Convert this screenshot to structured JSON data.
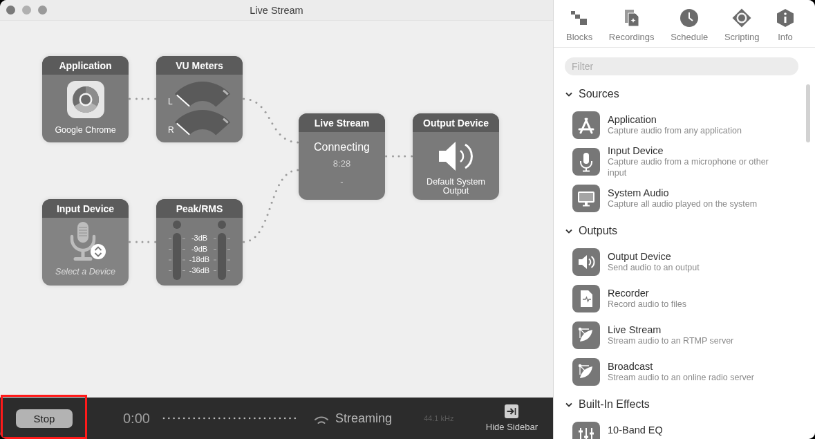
{
  "window": {
    "title": "Live Stream"
  },
  "canvas": {
    "nodes": [
      {
        "kind": "application",
        "title": "Application",
        "label": "Google Chrome"
      },
      {
        "kind": "vu_meters",
        "title": "VU Meters",
        "channels": [
          "L",
          "R"
        ]
      },
      {
        "kind": "live_stream",
        "title": "Live Stream",
        "status": "Connecting",
        "time": "8:28",
        "detail": "-"
      },
      {
        "kind": "output_device",
        "title": "Output Device",
        "label": "Default System Output"
      },
      {
        "kind": "input_device",
        "title": "Input Device",
        "prompt": "Select a Device"
      },
      {
        "kind": "peak_rms",
        "title": "Peak/RMS",
        "scale": [
          "-3dB",
          "-9dB",
          "-18dB",
          "-36dB"
        ]
      }
    ]
  },
  "sidebar": {
    "tabs": [
      {
        "kind": "blocks",
        "label": "Blocks"
      },
      {
        "kind": "recordings",
        "label": "Recordings"
      },
      {
        "kind": "schedule",
        "label": "Schedule"
      },
      {
        "kind": "scripting",
        "label": "Scripting"
      },
      {
        "kind": "info",
        "label": "Info"
      }
    ],
    "filter": {
      "placeholder": "Filter"
    },
    "sections": [
      {
        "title": "Sources",
        "expanded": true,
        "items": [
          {
            "kind": "application",
            "name": "Application",
            "description": "Capture audio from any application"
          },
          {
            "kind": "input_device",
            "name": "Input Device",
            "description": "Capture audio from a microphone or other input"
          },
          {
            "kind": "system_audio",
            "name": "System Audio",
            "description": "Capture all audio played on the system"
          }
        ]
      },
      {
        "title": "Outputs",
        "expanded": true,
        "items": [
          {
            "kind": "output_device",
            "name": "Output Device",
            "description": "Send audio to an output"
          },
          {
            "kind": "recorder",
            "name": "Recorder",
            "description": "Record audio to files"
          },
          {
            "kind": "live_stream",
            "name": "Live Stream",
            "description": "Stream audio to an RTMP server"
          },
          {
            "kind": "broadcast",
            "name": "Broadcast",
            "description": "Stream audio to an online radio server"
          }
        ]
      },
      {
        "title": "Built-In Effects",
        "expanded": true,
        "items": [
          {
            "kind": "eq",
            "name": "10-Band EQ"
          }
        ]
      }
    ]
  },
  "bottom_bar": {
    "stop_button": {
      "label": "Stop",
      "highlighted": true
    },
    "elapsed": "0:00",
    "status": "Streaming",
    "sample_rate": "44.1 kHz",
    "hide_sidebar": {
      "label": "Hide Sidebar"
    }
  }
}
